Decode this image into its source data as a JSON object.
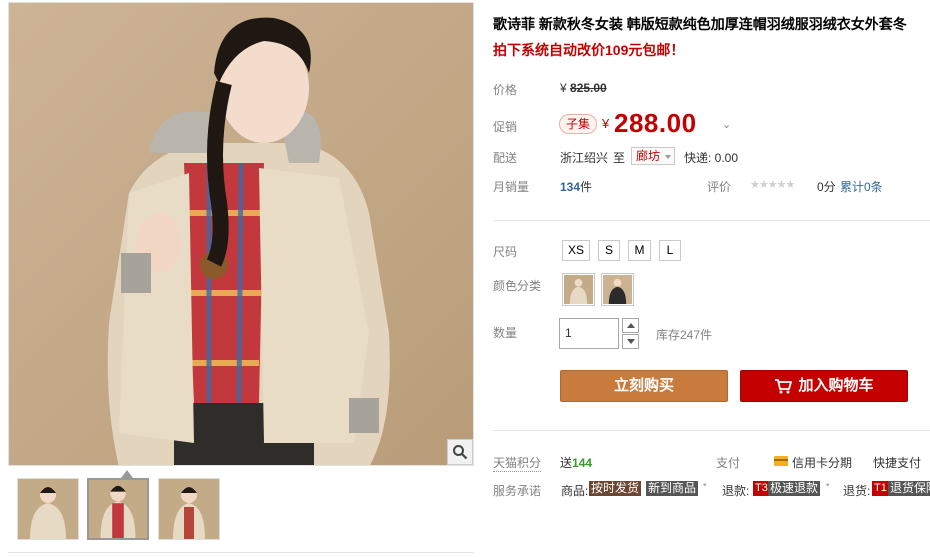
{
  "product": {
    "title": "歌诗菲 新款秋冬女装 韩版短款纯色加厚连帽羽绒服羽绒衣女外套冬",
    "subtitle": "拍下系统自动改价109元包邮！"
  },
  "price": {
    "label": "价格",
    "currency": "¥",
    "original": "825.00"
  },
  "promo": {
    "label": "促销",
    "tag": "子集",
    "currency": "¥",
    "price": "288.00",
    "dropdown_icon": "chevron-down-icon"
  },
  "delivery": {
    "label": "配送",
    "from": "浙江绍兴",
    "to_word": "至",
    "city": "廊坊",
    "express": "快递: 0.00"
  },
  "sales": {
    "label": "月销量",
    "count": "134",
    "unit": "件",
    "rating_label": "评价",
    "stars": "★★★★★",
    "score": "0分",
    "reviews": "累计0条"
  },
  "options": {
    "size_label": "尺码",
    "sizes": [
      "XS",
      "S",
      "M",
      "L"
    ],
    "color_label": "颜色分类",
    "colors": [
      "米白",
      "黑色"
    ],
    "colors_hex": [
      "#d9c9ad",
      "#2b2b2b"
    ]
  },
  "quantity": {
    "label": "数量",
    "value": "1",
    "stock": "库存247件"
  },
  "actions": {
    "buy_now": "立刻购买",
    "add_to_cart": "加入购物车"
  },
  "points": {
    "label": "天猫积分",
    "give_word": "送",
    "value": "144",
    "pay_label": "支付",
    "credit_installment": "信用卡分期",
    "fast_pay": "快捷支付"
  },
  "service": {
    "label": "服务承诺",
    "goods_prefix": "商品:",
    "badge_ontime": "按时发货",
    "badge_new": "新到商品",
    "refund_prefix": "退款:",
    "refund_code": "T3",
    "refund_badge": "极速退款",
    "return_prefix": "退货:",
    "return_code": "T1",
    "return_badge": "退货保障"
  },
  "colors": {
    "accent_red": "#c40000",
    "buy_orange": "#c97a3d",
    "link_blue": "#336699",
    "points_green": "#3a9a2a"
  }
}
